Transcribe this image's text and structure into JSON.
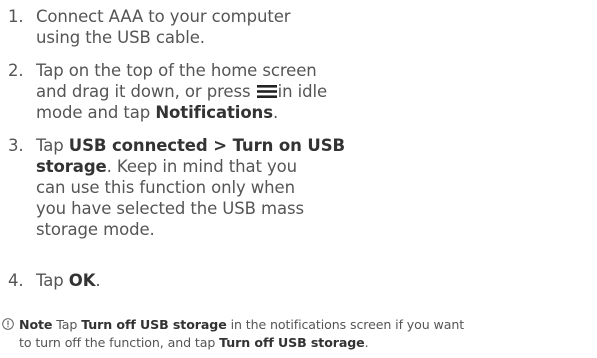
{
  "steps": [
    {
      "number": "1.",
      "line1": "Connect AAA to your computer",
      "line2": "using the USB cable."
    },
    {
      "number": "2.",
      "line1": "Tap on the top of the home screen",
      "line2_a": "and drag it down, or press",
      "line2_b": "in idle",
      "line3_a": "mode and tap",
      "line3_b": "Notifications",
      "line3_c": "."
    },
    {
      "number": "3.",
      "line1_a": "Tap",
      "line1_b": "USB connected > Turn on USB",
      "line2_a": "storage",
      "line2_b": ". Keep in mind that you",
      "line3": "can use this function only when",
      "line4": "you have selected the USB mass",
      "line5": "storage mode."
    },
    {
      "number": "4.",
      "text_a": "Tap",
      "text_b": "OK",
      "text_c": "."
    }
  ],
  "note": {
    "icon": "info-circle-icon",
    "label": "Note",
    "a": "Tap",
    "b": "Turn off USB storage",
    "c": "in the notifications screen if you want",
    "d": "to turn off the function, and tap",
    "e": "Turn off USB storage",
    "f": "."
  },
  "icons": {
    "menu": "menu-key-icon"
  },
  "colors": {
    "text": "#555555",
    "bold": "#333333"
  }
}
